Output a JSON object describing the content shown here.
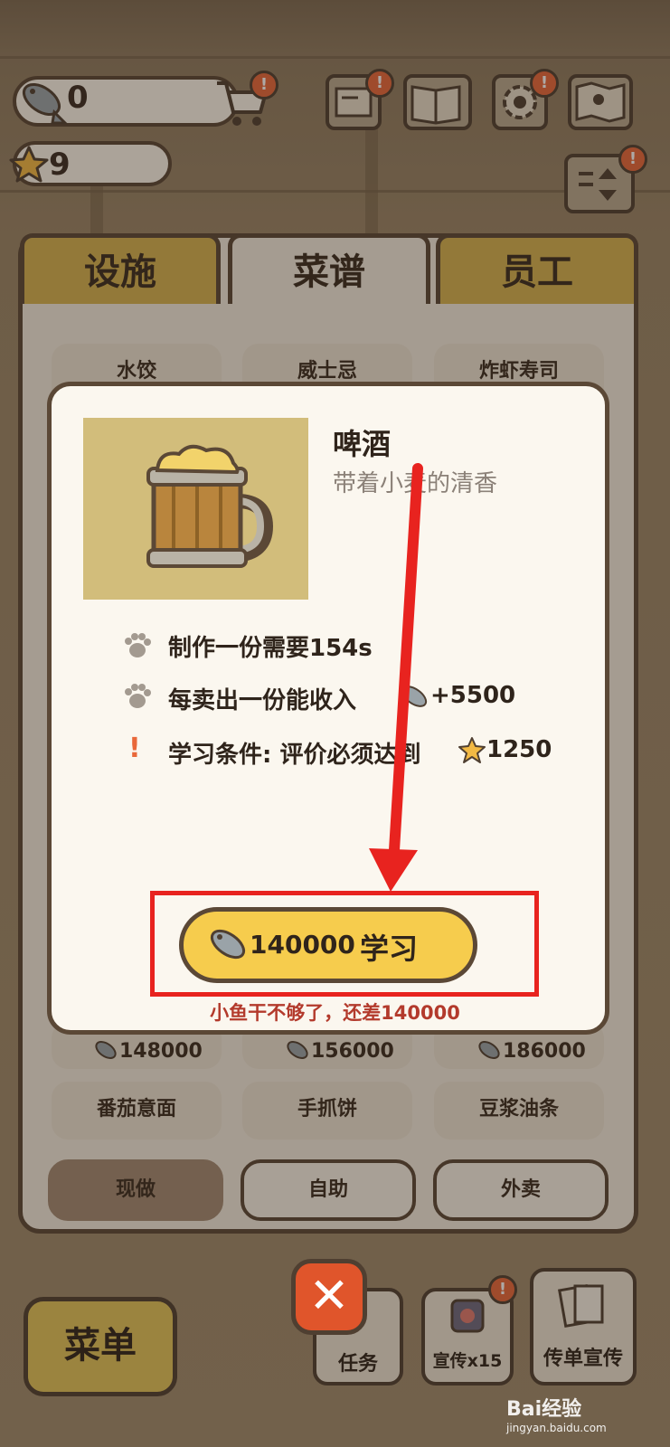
{
  "hud": {
    "fish_count": "0",
    "star_count": "9",
    "alert_mark": "!"
  },
  "tabs": [
    {
      "label": "设施"
    },
    {
      "label": "菜谱"
    },
    {
      "label": "员工"
    }
  ],
  "recipe_grid": {
    "row1": [
      "水饺",
      "威士忌",
      "炸虾寿司"
    ],
    "prices": [
      "148000",
      "156000",
      "186000"
    ],
    "row3": [
      "番茄意面",
      "手抓饼",
      "豆浆油条"
    ]
  },
  "filters": {
    "now": "现做",
    "self": "自助",
    "delivery": "外卖"
  },
  "modal": {
    "name": "啤酒",
    "description": "带着小麦的清香",
    "make_time": "制作一份需要154s",
    "income_prefix": "每卖出一份能收入",
    "income_value": "+5500",
    "condition_prefix": "学习条件: 评价必须达到",
    "condition_value": "1250",
    "learn_cost": "140000",
    "learn_label": "学习",
    "warning": "小鱼干不够了，还差140000"
  },
  "bottom": {
    "menu": "菜单",
    "task": "任务",
    "promo": "宣传x15",
    "flyer": "传单宣传",
    "close_symbol": "✕"
  },
  "watermark": {
    "brand": "Bai经验",
    "url": "jingyan.baidu.com"
  },
  "colors": {
    "accent_yellow": "#f6cc4d",
    "tab_gold": "#d5b24f",
    "annotation_red": "#e8231f",
    "warning_text": "#b33a2c",
    "close_orange": "#e0552b"
  }
}
